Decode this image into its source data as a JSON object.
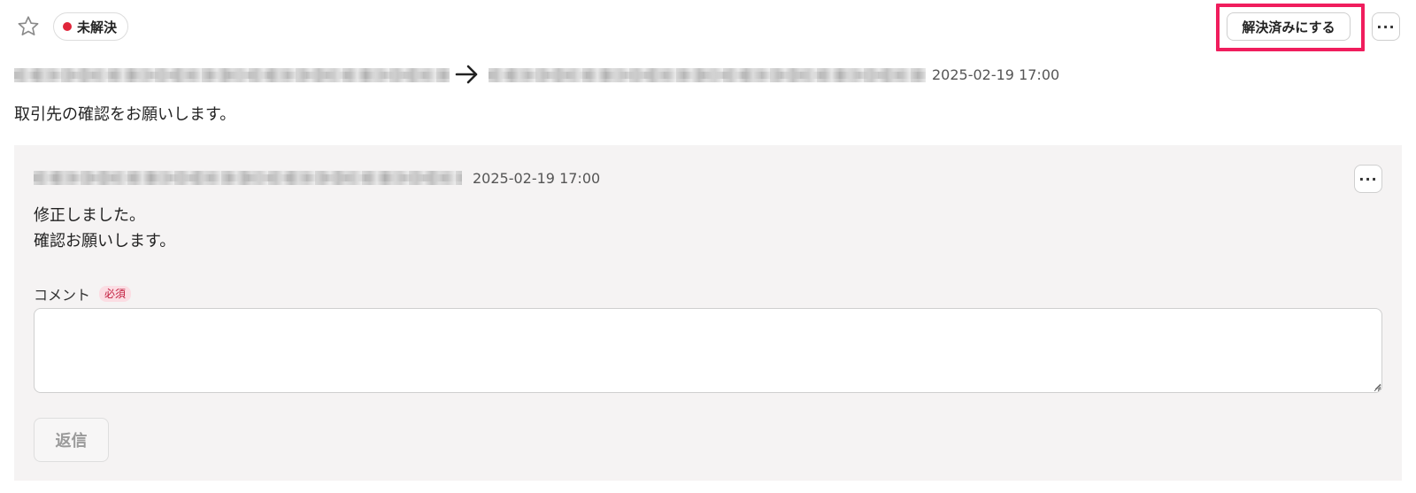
{
  "header": {
    "status_label": "未解決",
    "status_color": "#e0253a",
    "resolve_button_label": "解決済みにする",
    "more_label": "···",
    "highlight_color": "#f01d5d"
  },
  "thread": {
    "timestamp": "2025-02-19 17:00",
    "message": "取引先の確認をお願いします。"
  },
  "reply": {
    "timestamp": "2025-02-19 17:00",
    "more_label": "···",
    "body_line1": "修正しました。",
    "body_line2": "確認お願いします。"
  },
  "comment_form": {
    "label": "コメント",
    "required_label": "必須",
    "value": "",
    "submit_label": "返信"
  }
}
